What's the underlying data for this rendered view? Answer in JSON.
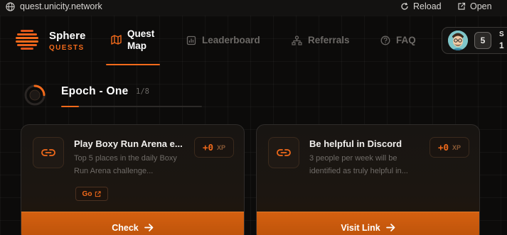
{
  "browser": {
    "url": "quest.unicity.network",
    "reload_label": "Reload",
    "open_label": "Open"
  },
  "brand": {
    "name": "Sphere",
    "subtitle": "QUESTS"
  },
  "nav": {
    "quest_map": "Quest Map",
    "leaderboard": "Leaderboard",
    "referrals": "Referrals",
    "faq": "FAQ"
  },
  "profile": {
    "level": "5",
    "name_fragment": "S",
    "value_fragment": "1"
  },
  "epoch": {
    "title": "Epoch - One",
    "count": "1/8",
    "progress": 0.125
  },
  "quests": [
    {
      "title": "Play Boxy Run Arena e...",
      "description": "Top 5 places in the daily Boxy Run Arena challenge...",
      "xp_value": "+0",
      "xp_unit": "XP",
      "go_label": "Go",
      "action_label": "Check"
    },
    {
      "title": "Be helpful in Discord",
      "description": "3 people per week will be identified as truly helpful in...",
      "xp_value": "+0",
      "xp_unit": "XP",
      "action_label": "Visit Link"
    }
  ],
  "colors": {
    "accent": "#f26a1b",
    "background": "#0c0b0a",
    "button": "#c85a0c"
  }
}
